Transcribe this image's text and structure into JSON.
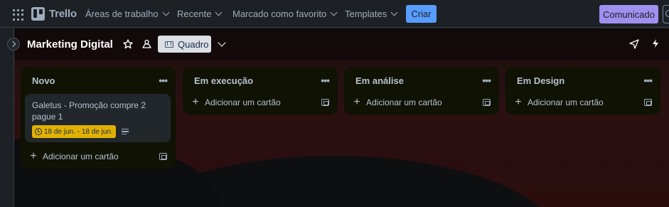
{
  "topnav": {
    "app_name": "Trello",
    "items": [
      {
        "label": "Áreas de trabalho"
      },
      {
        "label": "Recente"
      },
      {
        "label": "Marcado como favorito"
      },
      {
        "label": "Templates"
      }
    ],
    "create_label": "Criar",
    "announce_label": "Comunicado"
  },
  "board": {
    "title": "Marketing Digital",
    "view_label": "Quadro",
    "lists": [
      {
        "title": "Novo",
        "cards": [
          {
            "title": "Galetus - Promoção compre 2 pague 1",
            "due": "18 de jun. - 18 de jun."
          }
        ],
        "add_label": "Adicionar um cartão"
      },
      {
        "title": "Em execução",
        "cards": [],
        "add_label": "Adicionar um cartão"
      },
      {
        "title": "Em análise",
        "cards": [],
        "add_label": "Adicionar um cartão"
      },
      {
        "title": "Em Design",
        "cards": [],
        "add_label": "Adicionar um cartão"
      }
    ]
  },
  "colors": {
    "accent": "#579dff",
    "announce": "#9f8fef",
    "due_badge": "#e2b203",
    "list_bg": "#101204"
  }
}
